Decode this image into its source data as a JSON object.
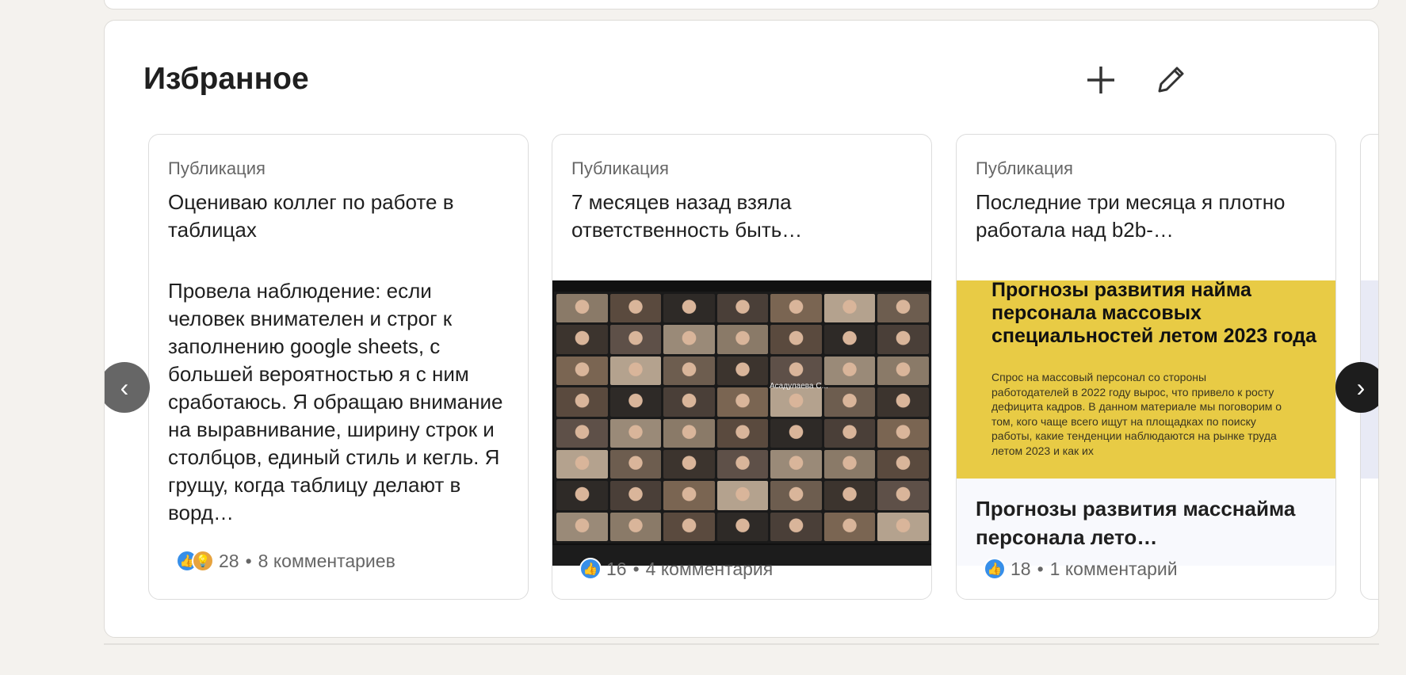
{
  "section": {
    "title": "Избранное",
    "add_icon": "plus-icon",
    "edit_icon": "pencil-icon"
  },
  "cards": [
    {
      "type": "Публикация",
      "headline": "Оцениваю коллег по работе в таблицах",
      "body": "Провела наблюдение: если человек внимателен и строг к заполнению google sheets, с большей вероятностью я с ним сработаюсь. Я обращаю внимание на выравнивание, ширину строк и столбцов, единый стиль и кегль. Я грущу, когда таблицу делают в ворд…",
      "reactions": "28",
      "comments": "8 комментариев"
    },
    {
      "type": "Публикация",
      "headline": "7 месяцев назад взяла ответственность быть…",
      "reactions": "16",
      "comments": "4 комментария",
      "image_caption": "Асадулаева С..."
    },
    {
      "type": "Публикация",
      "headline": "Последние три месяца я плотно работала над b2b-…",
      "image_title": "Прогнозы развития найма персонала массовых специальностей летом 2023 года",
      "image_text": "Спрос на массовый персонал со стороны работодателей в 2022 году вырос, что привело к росту дефицита кадров. В данном материале мы поговорим о том, кого чаще всего ищут на площадках по поиску работы, какие тенденции наблюдаются на рынке труда летом 2023 и как их",
      "article_title": "Прогнозы развития масснайма персонала лето…",
      "reactions": "18",
      "comments": "1 комментарий"
    }
  ],
  "separator": "•",
  "colors": {
    "like": "#378fe9",
    "insightful": "#e7a33e",
    "nav_dark": "#1d1d1d",
    "nav_gray": "#666666",
    "image_yellow": "#e8cb45"
  }
}
